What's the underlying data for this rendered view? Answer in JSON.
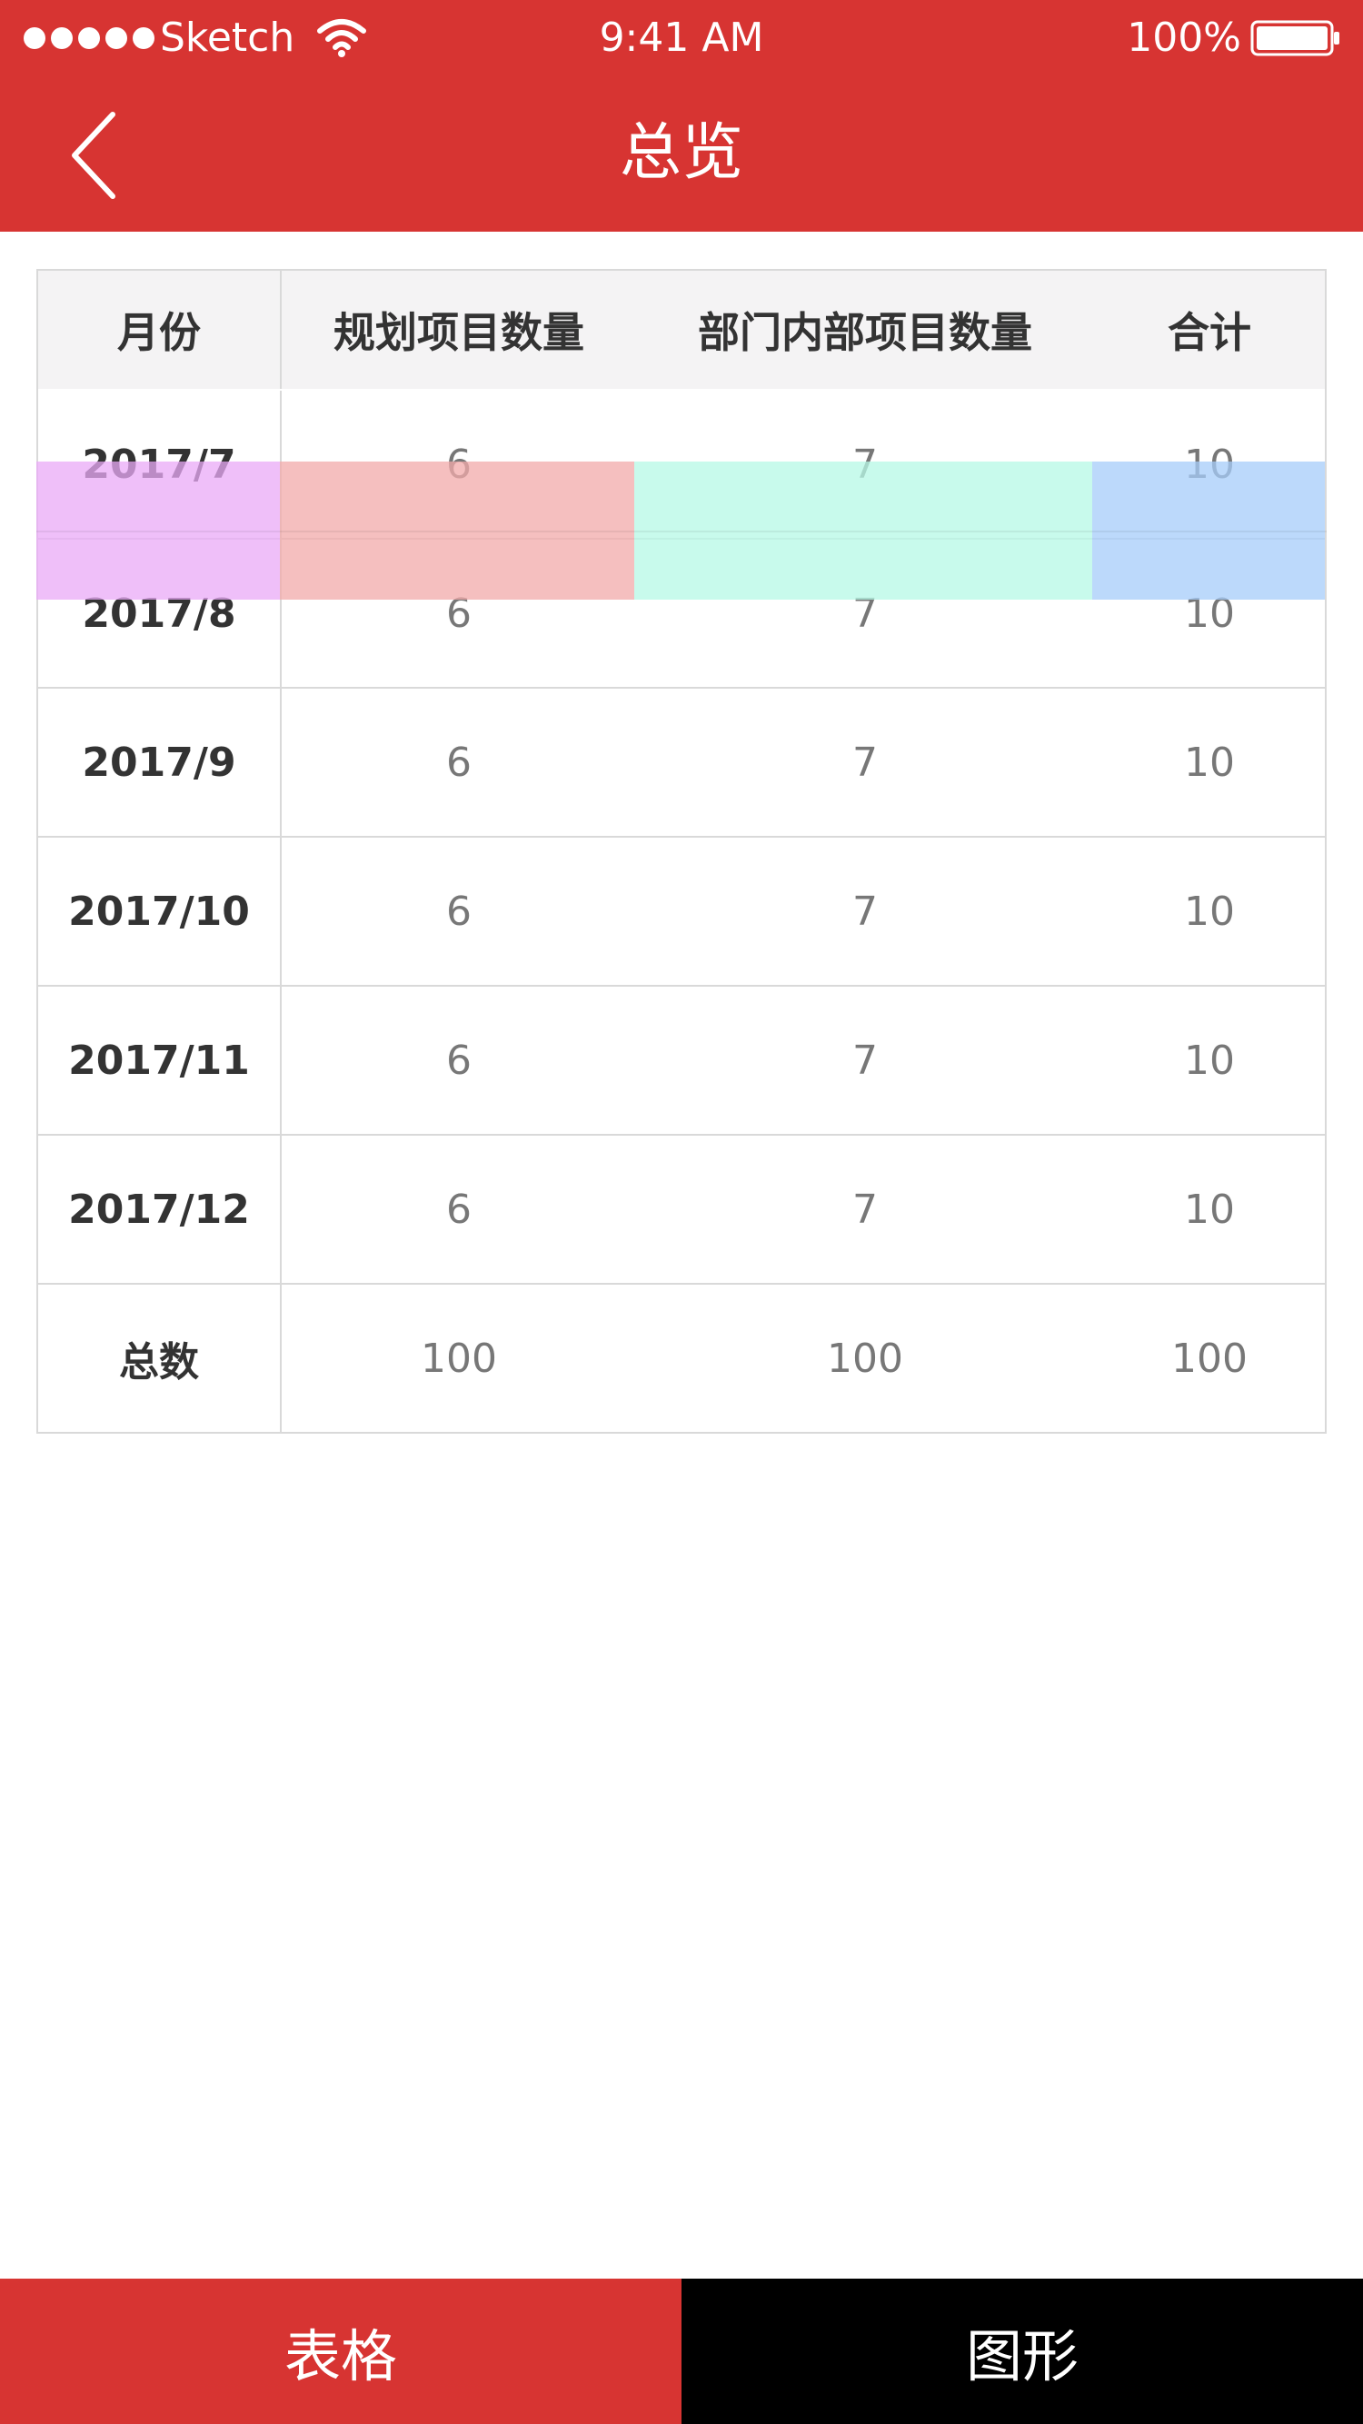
{
  "status_bar": {
    "carrier": "Sketch",
    "time": "9:41 AM",
    "battery": "100%"
  },
  "nav": {
    "title": "总览",
    "back_icon": "chevron-left-icon"
  },
  "table": {
    "headers": [
      "月份",
      "规划项目数量",
      "部门内部项目数量",
      "合计"
    ],
    "rows": [
      {
        "month": "2017/7",
        "planned": "6",
        "internal": "7",
        "total": "10"
      },
      {
        "month": "2017/8",
        "planned": "6",
        "internal": "7",
        "total": "10"
      },
      {
        "month": "2017/9",
        "planned": "6",
        "internal": "7",
        "total": "10"
      },
      {
        "month": "2017/10",
        "planned": "6",
        "internal": "7",
        "total": "10"
      },
      {
        "month": "2017/11",
        "planned": "6",
        "internal": "7",
        "total": "10"
      },
      {
        "month": "2017/12",
        "planned": "6",
        "internal": "7",
        "total": "10"
      },
      {
        "month": "总数",
        "planned": "100",
        "internal": "100",
        "total": "100"
      }
    ]
  },
  "tabs": {
    "table_label": "表格",
    "chart_label": "图形"
  },
  "colors": {
    "brand_red": "#d73432",
    "tab_black": "#000000",
    "highlight_purple": "#e9a9f7",
    "highlight_red": "#f2a9a9",
    "highlight_green": "#b5f8e6",
    "highlight_blue": "#a6ccf9"
  }
}
